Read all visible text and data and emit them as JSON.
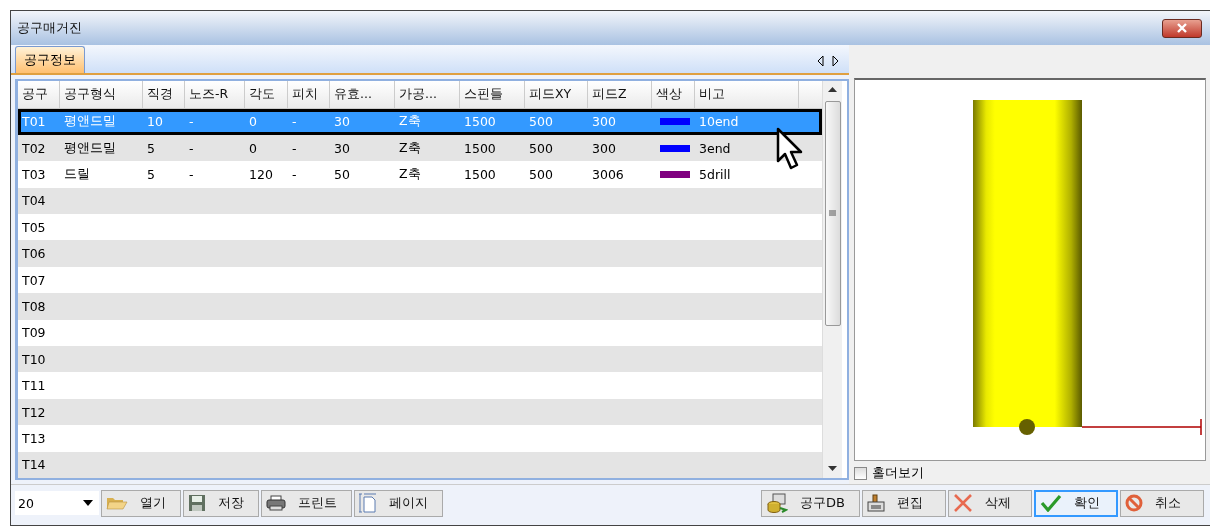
{
  "window": {
    "title": "공구매거진"
  },
  "tabs": [
    {
      "label": "공구정보",
      "selected": true
    }
  ],
  "grid": {
    "columns": [
      "공구",
      "공구형식",
      "직경",
      "노즈-R",
      "각도",
      "피치",
      "유효...",
      "가공...",
      "스핀들",
      "피드XY",
      "피드Z",
      "색상",
      "비고"
    ],
    "rows": [
      {
        "cells": [
          "T01",
          "평앤드밀",
          "10",
          "-",
          "0",
          "-",
          "30",
          "Z축",
          "1500",
          "500",
          "300",
          "",
          "10end"
        ],
        "color": "#0000ff",
        "selected": true
      },
      {
        "cells": [
          "T02",
          "평앤드밀",
          "5",
          "-",
          "0",
          "-",
          "30",
          "Z축",
          "1500",
          "500",
          "300",
          "",
          "3end"
        ],
        "color": "#0000ff",
        "selected": false
      },
      {
        "cells": [
          "T03",
          "드릴",
          "5",
          "-",
          "120",
          "-",
          "50",
          "Z축",
          "1500",
          "500",
          "3006",
          "",
          "5drill"
        ],
        "color": "#800080",
        "selected": false
      },
      {
        "cells": [
          "T04"
        ],
        "selected": false
      },
      {
        "cells": [
          "T05"
        ],
        "selected": false
      },
      {
        "cells": [
          "T06"
        ],
        "selected": false
      },
      {
        "cells": [
          "T07"
        ],
        "selected": false
      },
      {
        "cells": [
          "T08"
        ],
        "selected": false
      },
      {
        "cells": [
          "T09"
        ],
        "selected": false
      },
      {
        "cells": [
          "T10"
        ],
        "selected": false
      },
      {
        "cells": [
          "T11"
        ],
        "selected": false
      },
      {
        "cells": [
          "T12"
        ],
        "selected": false
      },
      {
        "cells": [
          "T13"
        ],
        "selected": false
      },
      {
        "cells": [
          "T14"
        ],
        "selected": false
      }
    ]
  },
  "holder_view": {
    "label": "홀더보기",
    "checked": false
  },
  "page_size": {
    "value": "20"
  },
  "left_buttons": [
    {
      "label": "열기",
      "kind": "open"
    },
    {
      "label": "저장",
      "kind": "save"
    },
    {
      "label": "프린트",
      "kind": "print"
    },
    {
      "label": "페이지",
      "kind": "page"
    }
  ],
  "right_buttons": [
    {
      "label": "공구DB",
      "kind": "db",
      "focused": false
    },
    {
      "label": "편집",
      "kind": "edit",
      "focused": false
    },
    {
      "label": "삭제",
      "kind": "delete",
      "focused": false
    },
    {
      "label": "확인",
      "kind": "ok",
      "focused": true
    },
    {
      "label": "취소",
      "kind": "cancel",
      "focused": false
    }
  ]
}
